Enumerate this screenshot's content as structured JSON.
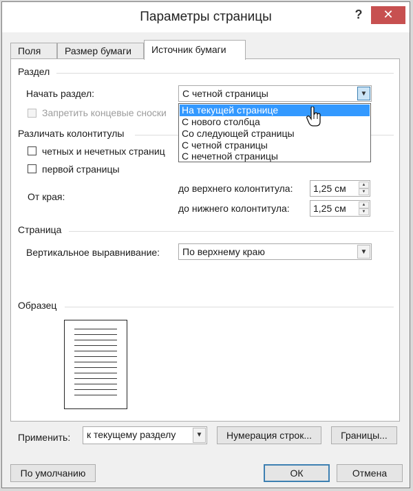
{
  "window": {
    "title": "Параметры страницы",
    "help_label": "?",
    "close_glyph": "✕"
  },
  "tabs": [
    {
      "label": "Поля"
    },
    {
      "label": "Размер бумаги"
    },
    {
      "label": "Источник бумаги",
      "active": true
    }
  ],
  "section": {
    "title": "Раздел",
    "start_label": "Начать раздел:",
    "start_value": "С четной страницы",
    "suppress_endnotes_label": "Запретить концевые сноски",
    "dropdown_options": [
      "На текущей странице",
      "С нового столбца",
      "Со следующей страницы",
      "С четной страницы",
      "С нечетной страницы"
    ],
    "dropdown_highlighted": "На текущей странице"
  },
  "headers_footers": {
    "title": "Различать колонтитулы",
    "odd_even_label": "четных и нечетных страниц",
    "first_page_label": "первой страницы",
    "from_edge_label": "От края:",
    "header_label": "до верхнего колонтитула:",
    "header_value": "1,25 см",
    "footer_label": "до нижнего колонтитула:",
    "footer_value": "1,25 см"
  },
  "page": {
    "title": "Страница",
    "valign_label": "Вертикальное выравнивание:",
    "valign_value": "По верхнему краю"
  },
  "preview": {
    "title": "Образец"
  },
  "apply": {
    "label": "Применить:",
    "value": "к текущему разделу",
    "line_numbers_button": "Нумерация строк...",
    "borders_button": "Границы..."
  },
  "footer": {
    "default_button": "По умолчанию",
    "ok_button": "ОК",
    "cancel_button": "Отмена"
  },
  "colors": {
    "close_button": "#c75050",
    "selection": "#3399ff",
    "dialog_bg": "#f0f0f0"
  },
  "icons": [
    "help-icon",
    "close-icon",
    "dropdown-arrow-icon",
    "spin-up-icon",
    "spin-down-icon",
    "hand-cursor-icon"
  ]
}
